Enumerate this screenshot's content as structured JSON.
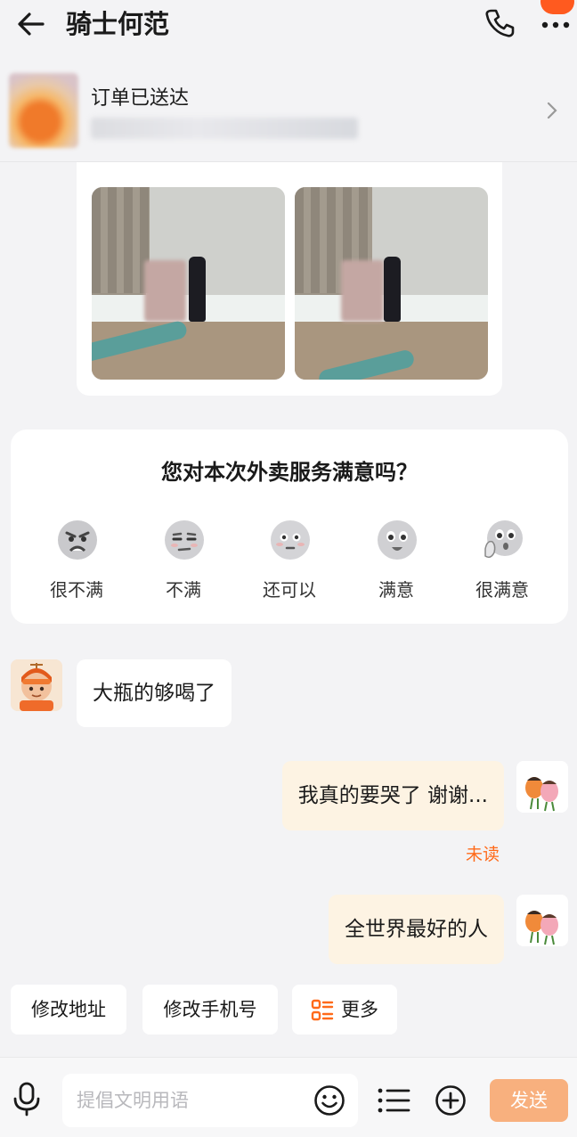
{
  "header": {
    "title": "骑士何范",
    "more_badge": "···"
  },
  "order": {
    "status": "订单已送达"
  },
  "photo_card": {
    "photos": [
      "delivery-photo-1",
      "delivery-photo-2"
    ]
  },
  "survey": {
    "question": "您对本次外卖服务满意吗？",
    "options": [
      {
        "label": "很不满",
        "icon": "angry-face-icon"
      },
      {
        "label": "不满",
        "icon": "displeased-face-icon"
      },
      {
        "label": "还可以",
        "icon": "neutral-face-icon"
      },
      {
        "label": "满意",
        "icon": "happy-face-icon"
      },
      {
        "label": "很满意",
        "icon": "delighted-face-icon"
      }
    ]
  },
  "messages": [
    {
      "side": "left",
      "text": "大瓶的够喝了"
    },
    {
      "side": "right",
      "text": "我真的要哭了 谢谢...",
      "status": "未读"
    },
    {
      "side": "right",
      "text": "全世界最好的人"
    }
  ],
  "quick_actions": [
    {
      "label": "修改地址"
    },
    {
      "label": "修改手机号"
    },
    {
      "label": "更多",
      "icon": "menu-grid-icon"
    }
  ],
  "input": {
    "placeholder": "提倡文明用语",
    "send_label": "发送"
  },
  "colors": {
    "accent": "#ff6a1a",
    "send_button": "#f8b07e",
    "right_bubble": "#fdf3e3"
  }
}
